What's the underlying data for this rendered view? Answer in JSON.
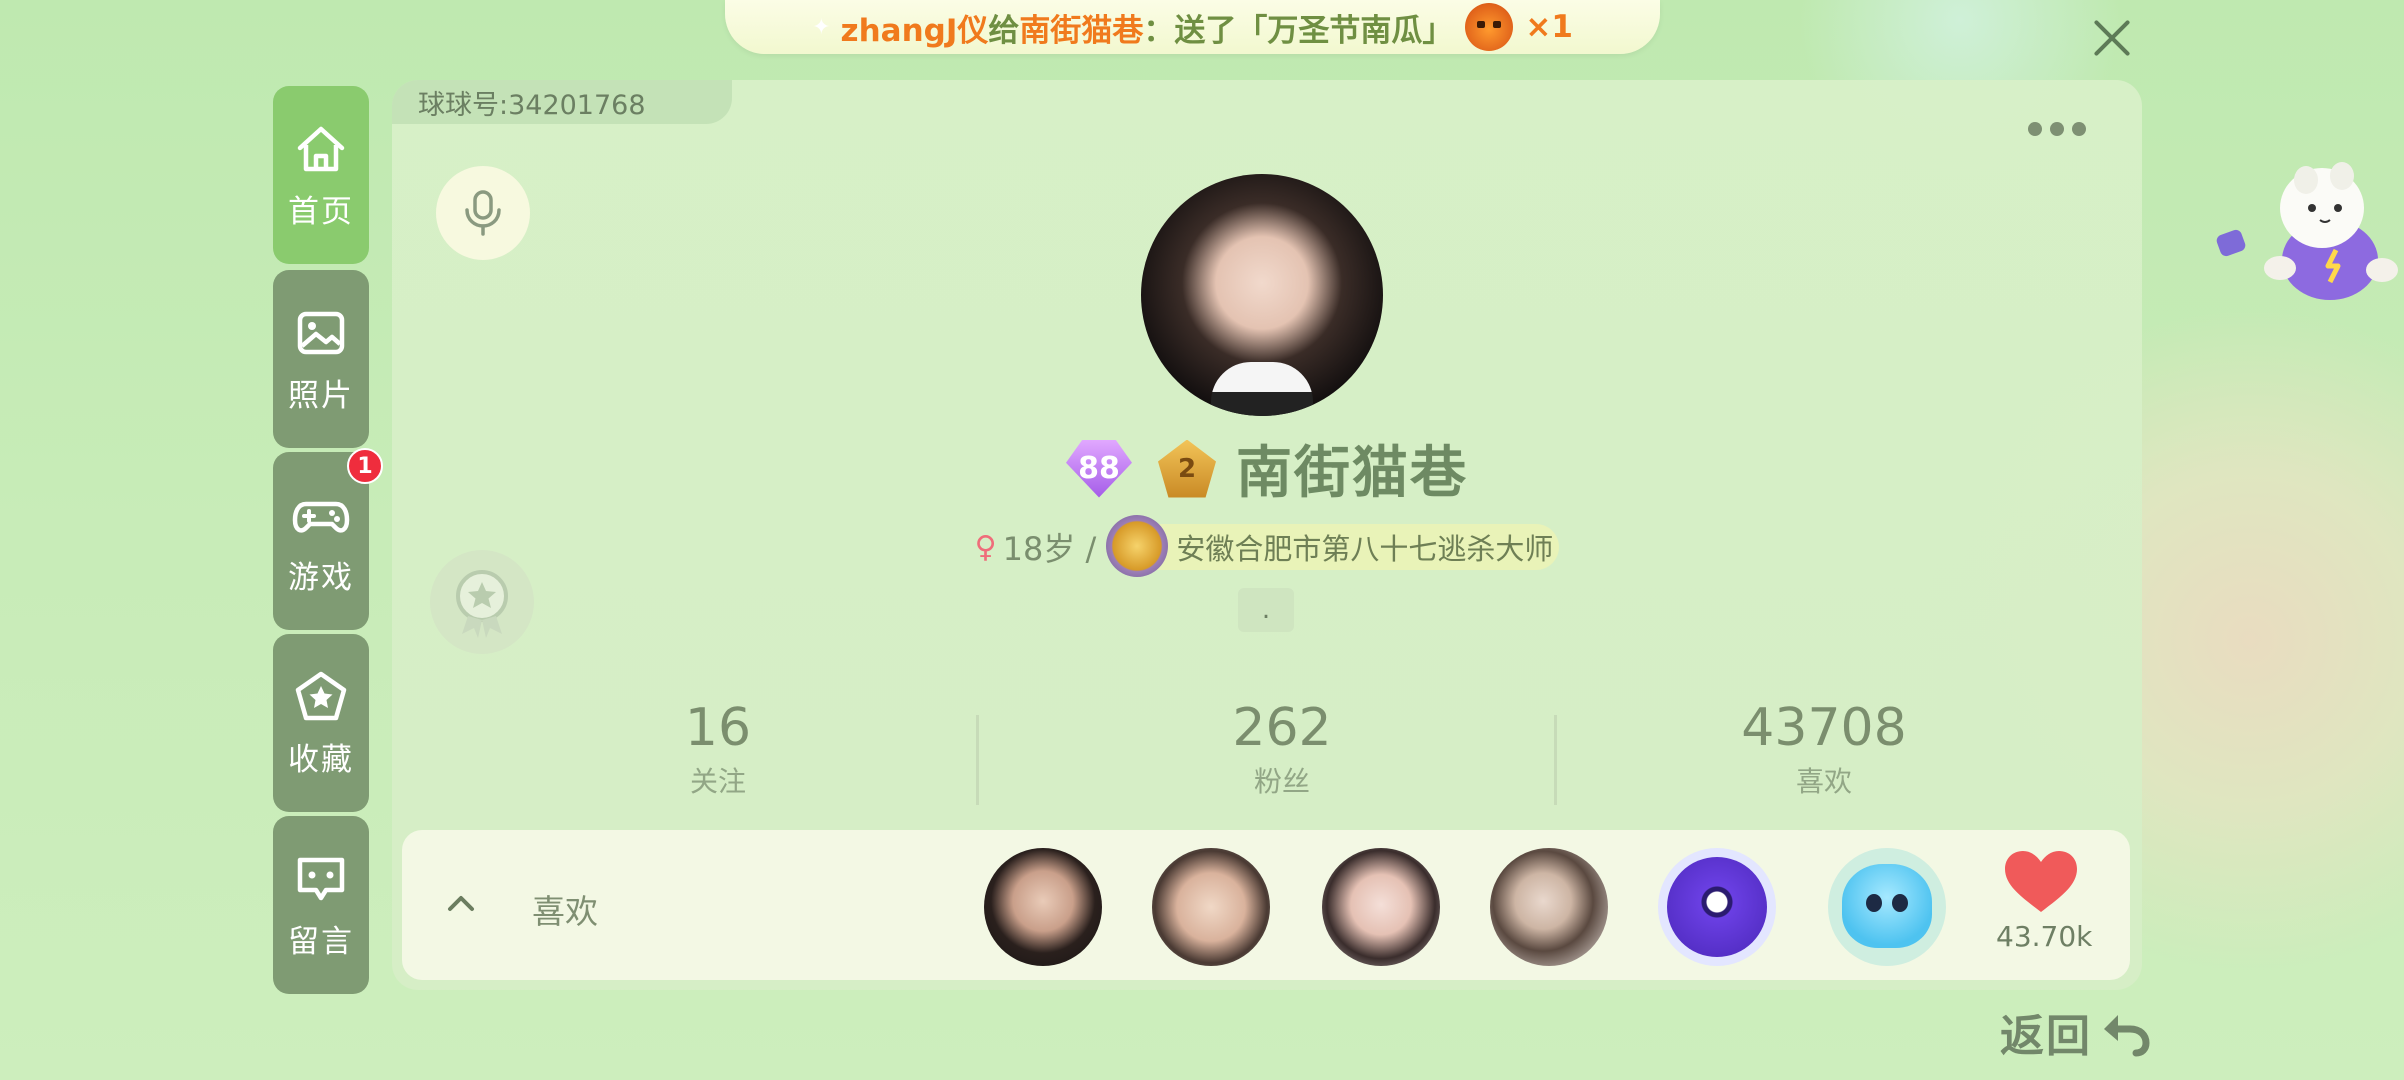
{
  "banner": {
    "sender": "zhangJ仪",
    "verb": "给",
    "receiver": "南街猫巷",
    "action": "：送了「万圣节南瓜」",
    "count": "×1"
  },
  "nav": {
    "items": [
      {
        "label": "首页",
        "icon": "home-icon",
        "active": true
      },
      {
        "label": "照片",
        "icon": "photo-icon"
      },
      {
        "label": "游戏",
        "icon": "gamepad-icon",
        "badge": "1"
      },
      {
        "label": "收藏",
        "icon": "star-icon"
      },
      {
        "label": "留言",
        "icon": "message-icon"
      }
    ]
  },
  "profile": {
    "uid_label": "球球号:34201768",
    "level": "88",
    "star_rank": "2",
    "name": "南街猫巷",
    "age": "18岁 /",
    "title": "安徽合肥市第八十七逃杀大师",
    "signature": "."
  },
  "stats": [
    {
      "value": "16",
      "label": "关注"
    },
    {
      "value": "262",
      "label": "粉丝"
    },
    {
      "value": "43708",
      "label": "喜欢"
    }
  ],
  "likes": {
    "label": "喜欢",
    "count": "43.70k"
  },
  "back_label": "返回",
  "colors": {
    "accent_green": "#8acb6e",
    "nav_gray_green": "#7f9b73",
    "banner_orange": "#f07a1d",
    "heart_red": "#f05a5a",
    "badge_red": "#ef2d3d"
  }
}
